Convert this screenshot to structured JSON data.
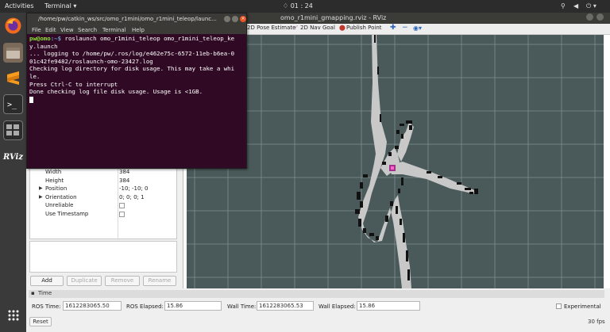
{
  "topbar": {
    "activities": "Activities",
    "app_menu": "Terminal ▾",
    "clock": "♢ 01 : 24"
  },
  "rviz": {
    "window_title": "omo_r1mini_gmapping.rviz - RViz",
    "toolbar": {
      "pose_estimate": "2D Pose Estimate",
      "nav_goal": "2D Nav Goal",
      "publish_point": "Publish Point"
    },
    "properties": [
      {
        "key": "Width",
        "value": "384",
        "expandable": false,
        "checkbox": false
      },
      {
        "key": "Height",
        "value": "384",
        "expandable": false,
        "checkbox": false
      },
      {
        "key": "Position",
        "value": "-10; -10; 0",
        "expandable": true,
        "checkbox": false
      },
      {
        "key": "Orientation",
        "value": "0; 0; 0; 1",
        "expandable": true,
        "checkbox": false
      },
      {
        "key": "Unreliable",
        "value": "",
        "expandable": false,
        "checkbox": true
      },
      {
        "key": "Use Timestamp",
        "value": "",
        "expandable": false,
        "checkbox": true
      }
    ],
    "buttons": {
      "add": "Add",
      "duplicate": "Duplicate",
      "remove": "Remove",
      "rename": "Rename"
    },
    "time_panel": {
      "header": "Time",
      "ros_time_label": "ROS Time:",
      "ros_time": "1612283065.50",
      "ros_elapsed_label": "ROS Elapsed:",
      "ros_elapsed": "15.86",
      "wall_time_label": "Wall Time:",
      "wall_time": "1612283065.53",
      "wall_elapsed_label": "Wall Elapsed:",
      "wall_elapsed": "15.86",
      "experimental": "Experimental",
      "reset": "Reset",
      "fps": "30 fps"
    }
  },
  "terminal": {
    "title": "/home/pw/catkin_ws/src/omo_r1mini/omo_r1mini_teleop/launc...",
    "menu": [
      "File",
      "Edit",
      "View",
      "Search",
      "Terminal",
      "Help"
    ],
    "prompt_user": "pw@omo",
    "prompt_path": ":~$",
    "command": " roslaunch omo_r1mini_teleop omo_r1mini_teleop_ke",
    "lines": [
      "y.launch",
      "... logging to /home/pw/.ros/log/e462e75c-6572-11eb-b6ea-0",
      "01c42fe9482/roslaunch-omo-23427.log",
      "Checking log directory for disk usage. This may take a whi",
      "le.",
      "Press Ctrl-C to interrupt",
      "Done checking log file disk usage. Usage is <1GB."
    ]
  },
  "dock": {
    "rviz_label": "RViz"
  },
  "colors": {
    "terminal_bg": "#300a24",
    "viewport_bg": "#4a5a5a",
    "map_free": "#c8c8c8",
    "map_occupied": "#111111"
  }
}
